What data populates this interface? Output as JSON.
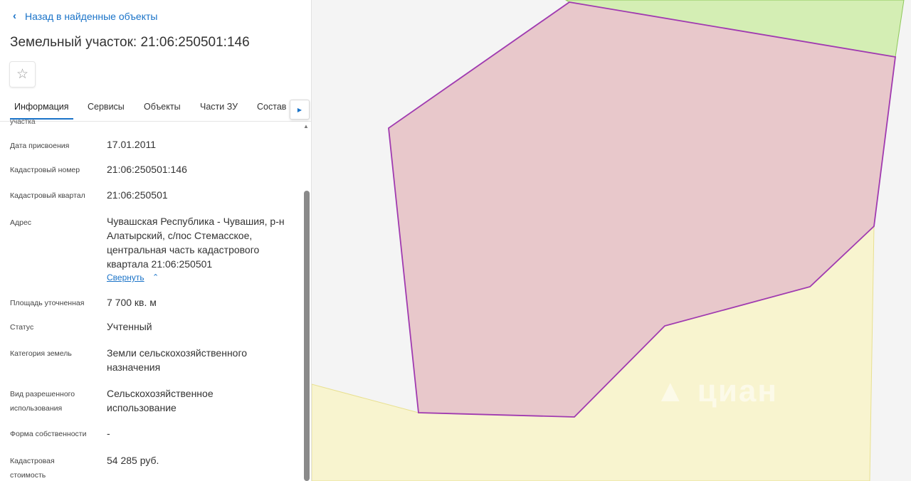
{
  "panel": {
    "back_label": "Назад в найденные объекты",
    "title": "Земельный участок: 21:06:250501:146",
    "star_icon": "star-icon",
    "tabs": [
      {
        "label": "Информация"
      },
      {
        "label": "Сервисы"
      },
      {
        "label": "Объекты"
      },
      {
        "label": "Части ЗУ"
      },
      {
        "label": "Состав"
      }
    ],
    "cut_text": "участка",
    "fields": {
      "date_label": "Дата присвоения",
      "date_value": "17.01.2011",
      "cad_num_label": "Кадастровый номер",
      "cad_num_value": "21:06:250501:146",
      "quarter_label": "Кадастровый квартал",
      "quarter_value": "21:06:250501",
      "address_label": "Адрес",
      "address_value": "Чувашская Республика - Чувашия, р-н Алатырский, с/пос Стемасское, центральная часть кадастрового квартала 21:06:250501",
      "collapse_label": "Свернуть",
      "area_label": "Площадь уточненная",
      "area_value": "7 700 кв. м",
      "status_label": "Статус",
      "status_value": "Учтенный",
      "category_label": "Категория земель",
      "category_value": "Земли сельскохозяйственного назначения",
      "usage_label": "Вид разрешенного использования",
      "usage_value": "Сельскохозяйственное использование",
      "ownership_label": "Форма собственности",
      "ownership_value": "-",
      "cost_label": "Кадастровая стоимость",
      "cost_value": "54 285 руб."
    }
  },
  "colors": {
    "accent": "#1a73c8",
    "parcel_fill": "#e8c8cb",
    "parcel_stroke": "#a03ab0",
    "green_fill": "#d4eeb4",
    "yellow_fill": "#f8f4cf"
  }
}
